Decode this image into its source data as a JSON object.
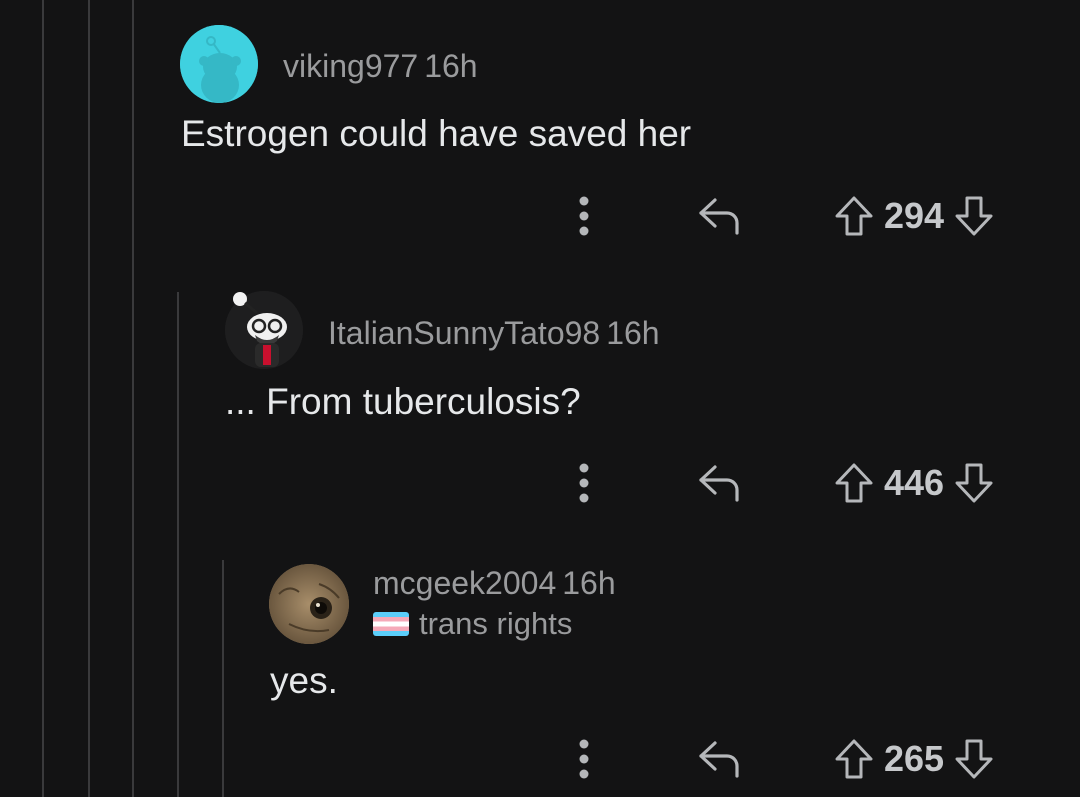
{
  "comments": [
    {
      "author": "viking977",
      "time": "16h",
      "body": "Estrogen could have saved her",
      "votes": "294",
      "avatar": "snoo-avatar-teal",
      "avatar_color": "#3fd1e0"
    },
    {
      "author": "ItalianSunnyTato98",
      "time": "16h",
      "body": "... From tuberculosis?",
      "votes": "446",
      "avatar": "snoo-avatar-glasses",
      "avatar_color": "#1c1c1d"
    },
    {
      "author": "mcgeek2004",
      "time": "16h",
      "flair": "trans rights",
      "flair_icon": "trans-flag-icon",
      "body": "yes.",
      "votes": "265",
      "avatar": "cat-photo-avatar",
      "avatar_color": "#8a7456"
    }
  ],
  "icons": {
    "more": "more-options-icon",
    "reply": "reply-icon",
    "upvote": "upvote-arrow-icon",
    "downvote": "downvote-arrow-icon"
  },
  "colors": {
    "background": "#131314",
    "thread_line": "#3a3a3c",
    "meta_text": "#9a9b9d",
    "body_text": "#e6e8ea"
  }
}
